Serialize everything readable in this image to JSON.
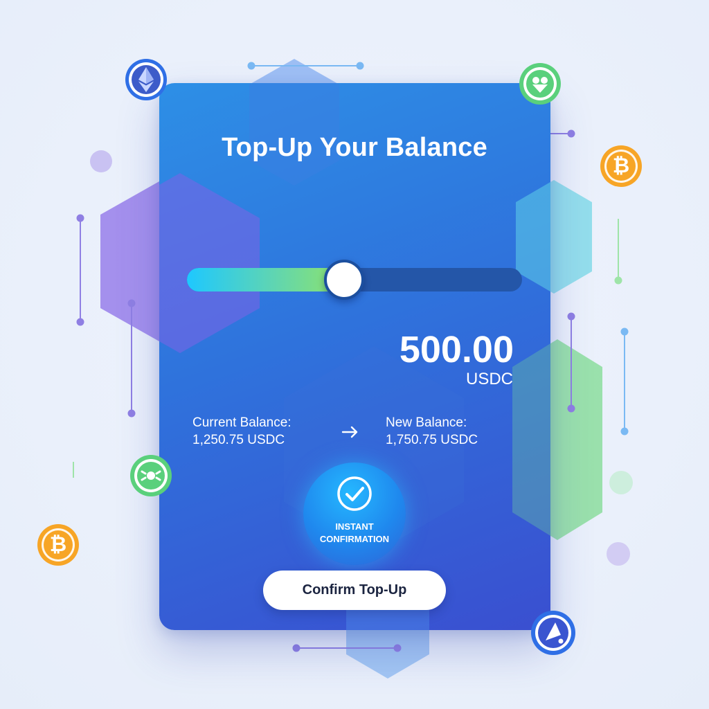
{
  "title": "Top-Up Your Balance",
  "slider": {
    "fill_fraction": 0.47
  },
  "amount": {
    "value": "500.00",
    "unit": "USDC"
  },
  "current_balance": {
    "label": "Current Balance:",
    "value": "1,250.75 USDC"
  },
  "new_balance": {
    "label": "New Balance:",
    "value": "1,750.75 USDC"
  },
  "badge": {
    "label": "INSTANT\nCONFIRMATION"
  },
  "confirm_button": {
    "label": "Confirm Top-Up"
  },
  "icons": {
    "transition": "arrow-right-icon",
    "badge": "check-circle-icon",
    "coins": [
      "ethereum-icon",
      "bitcoin-icon",
      "bitcoin-icon",
      "green-token-icon",
      "green-token-icon",
      "blue-token-icon"
    ]
  },
  "colors": {
    "card_top": "#2d8fe6",
    "card_bottom": "#3a4fd0",
    "slider_start": "#1ec8ff",
    "slider_end": "#8fe36a",
    "bitcoin": "#f7a526",
    "ethereum_ring": "#2f6fe6",
    "green_token": "#5ad07c"
  }
}
